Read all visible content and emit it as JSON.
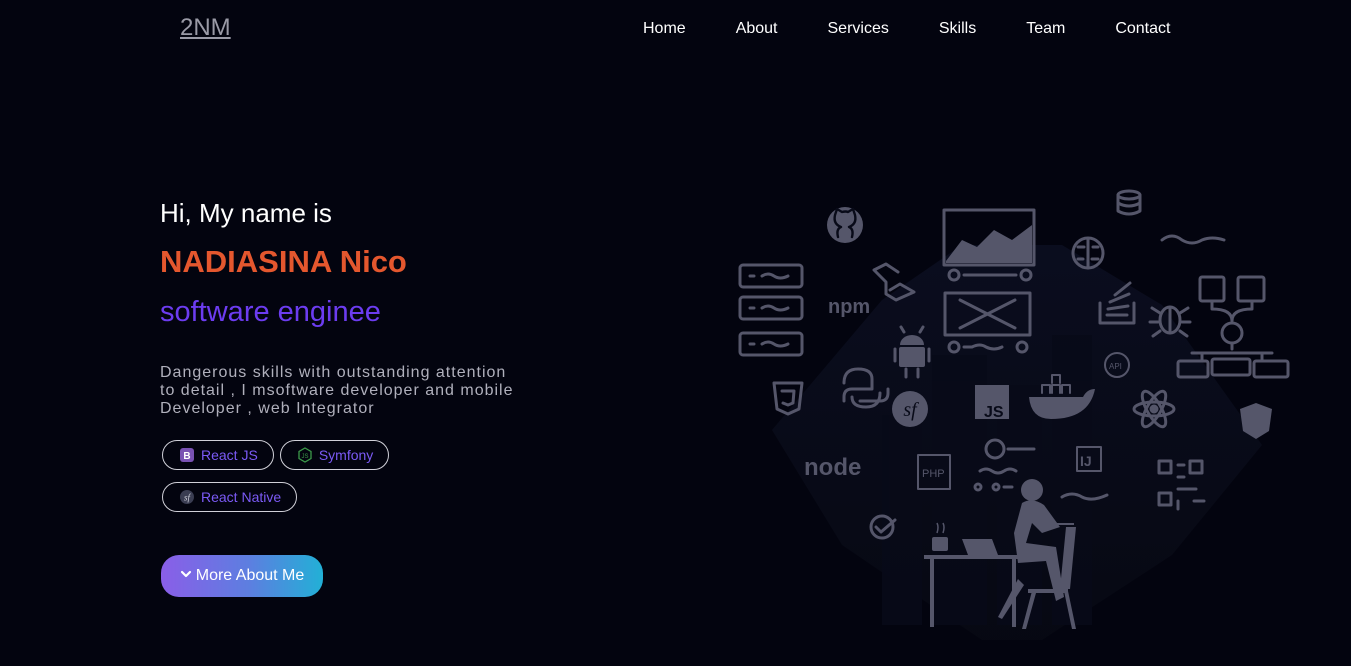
{
  "header": {
    "logo": "2NM",
    "nav": [
      {
        "label": "Home"
      },
      {
        "label": "About"
      },
      {
        "label": "Services"
      },
      {
        "label": "Skills"
      },
      {
        "label": "Team"
      },
      {
        "label": "Contact"
      }
    ]
  },
  "hero": {
    "greeting": "Hi, My name is",
    "name": "NADIASINA Nico",
    "role": "software enginee",
    "description": "Dangerous skills with outstanding attention to detail , I msoftware developer and mobile Developer , web Integrator",
    "tags": [
      {
        "label": "React JS",
        "icon": "bootstrap-icon"
      },
      {
        "label": "Symfony",
        "icon": "nodejs-icon"
      },
      {
        "label": "React Native",
        "icon": "symfony-icon"
      }
    ],
    "cta_label": "More About Me",
    "cta_icon": "chevron-down-icon"
  },
  "illustration": {
    "labels": {
      "npm": "npm",
      "js": "JS",
      "php": "PHP",
      "node": "node",
      "ij": "IJ",
      "api": "API"
    },
    "colors": {
      "icon_stroke": "#55566a",
      "shape_fill": "#0c0f22",
      "accent_name": "#e4572e",
      "accent_role": "#6c3cf0"
    }
  }
}
